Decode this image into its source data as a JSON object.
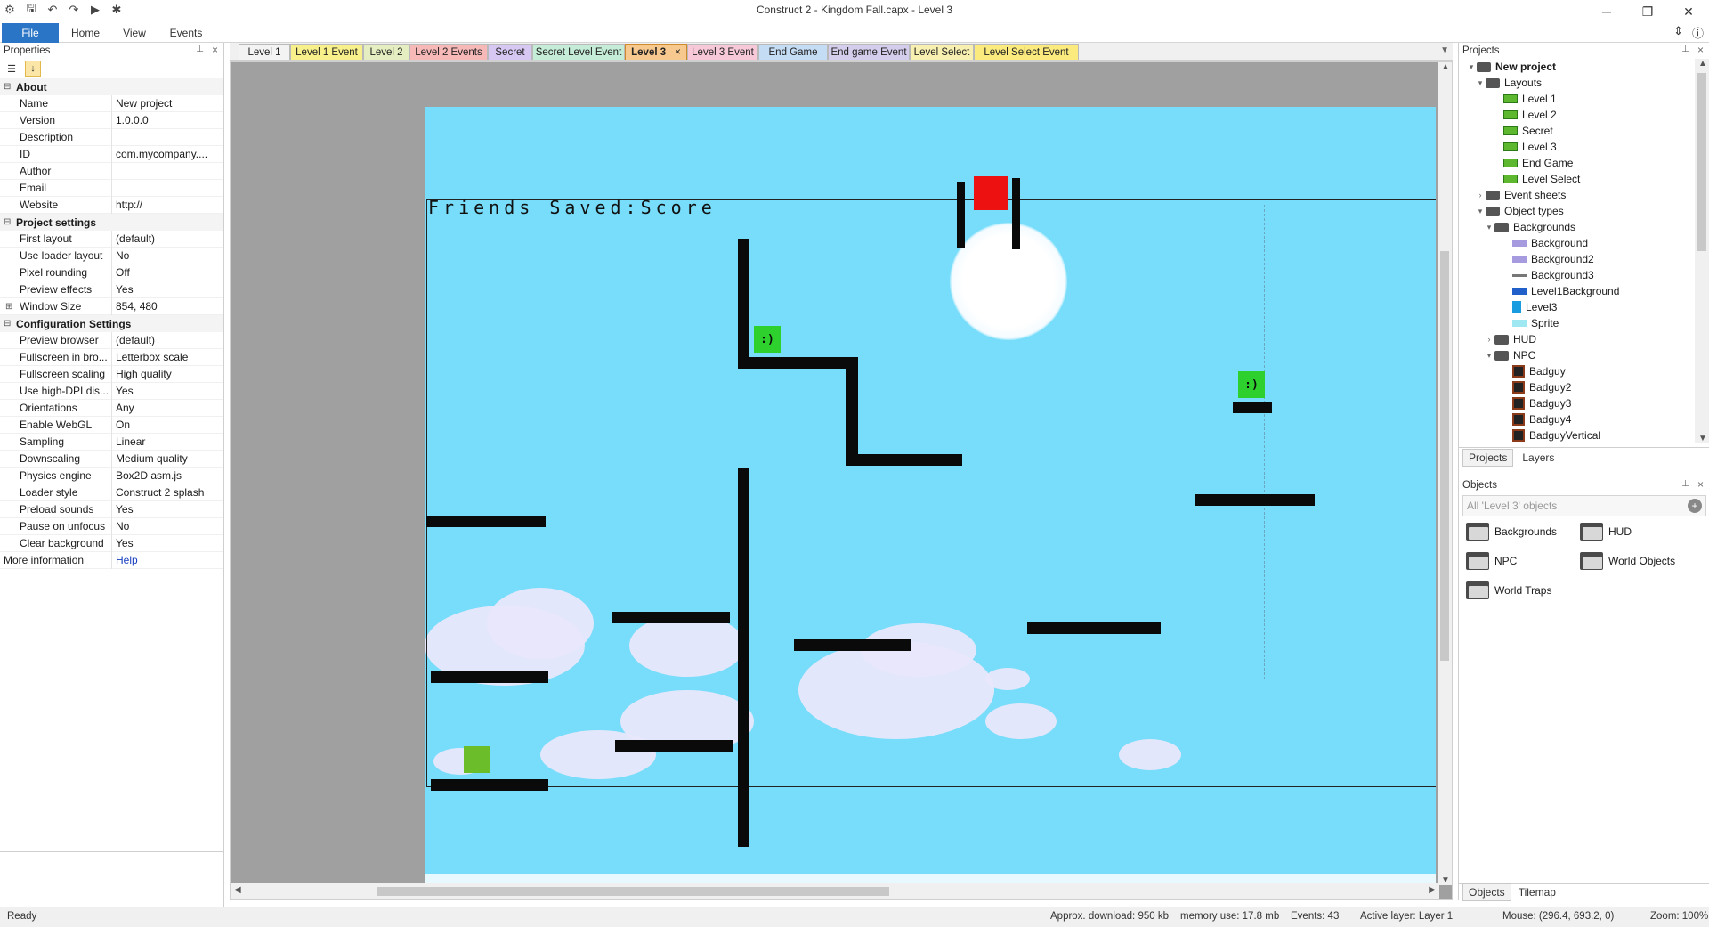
{
  "window": {
    "title": "Construct 2 - Kingdom Fall.capx - Level 3",
    "controls": [
      "─",
      "❐",
      "✕"
    ]
  },
  "ribbon": {
    "tabs": [
      "File",
      "Home",
      "View",
      "Events"
    ]
  },
  "properties": {
    "title": "Properties",
    "sections": {
      "about": "About",
      "project_settings": "Project settings",
      "config": "Configuration Settings"
    },
    "about": [
      {
        "k": "Name",
        "v": "New project"
      },
      {
        "k": "Version",
        "v": "1.0.0.0"
      },
      {
        "k": "Description",
        "v": ""
      },
      {
        "k": "ID",
        "v": "com.mycompany...."
      },
      {
        "k": "Author",
        "v": ""
      },
      {
        "k": "Email",
        "v": ""
      },
      {
        "k": "Website",
        "v": "http://"
      }
    ],
    "project": [
      {
        "k": "First layout",
        "v": "(default)"
      },
      {
        "k": "Use loader layout",
        "v": "No"
      },
      {
        "k": "Pixel rounding",
        "v": "Off"
      },
      {
        "k": "Preview effects",
        "v": "Yes"
      },
      {
        "k": "Window Size",
        "v": "854, 480"
      }
    ],
    "config": [
      {
        "k": "Preview browser",
        "v": "(default)"
      },
      {
        "k": "Fullscreen in bro...",
        "v": "Letterbox scale"
      },
      {
        "k": "Fullscreen scaling",
        "v": "High quality"
      },
      {
        "k": "Use high-DPI dis...",
        "v": "Yes"
      },
      {
        "k": "Orientations",
        "v": "Any"
      },
      {
        "k": "Enable WebGL",
        "v": "On"
      },
      {
        "k": "Sampling",
        "v": "Linear"
      },
      {
        "k": "Downscaling",
        "v": "Medium quality"
      },
      {
        "k": "Physics engine",
        "v": "Box2D asm.js"
      },
      {
        "k": "Loader style",
        "v": "Construct 2 splash"
      },
      {
        "k": "Preload sounds",
        "v": "Yes"
      },
      {
        "k": "Pause on unfocus",
        "v": "No"
      },
      {
        "k": "Clear background",
        "v": "Yes"
      }
    ],
    "more_info": {
      "k": "More information",
      "v": "Help"
    }
  },
  "doc_tabs": [
    {
      "label": "Level 1",
      "color": "#f3f3f3"
    },
    {
      "label": "Level 1 Event",
      "color": "#f8f08a"
    },
    {
      "label": "Level 2",
      "color": "#e4eec0"
    },
    {
      "label": "Level 2 Events",
      "color": "#f7b8b8"
    },
    {
      "label": "Secret",
      "color": "#d6c8f2"
    },
    {
      "label": "Secret Level Event",
      "color": "#c5ecd7"
    },
    {
      "label": "Level 3",
      "color": "#f7c98e",
      "active": true,
      "close": "×"
    },
    {
      "label": "Level 3 Event",
      "color": "#f7c8d8"
    },
    {
      "label": "End Game",
      "color": "#c4dcf4"
    },
    {
      "label": "End game Event",
      "color": "#d4cdeb"
    },
    {
      "label": "Level Select",
      "color": "#f7f0b0"
    },
    {
      "label": "Level Select Event",
      "color": "#fbea7d"
    }
  ],
  "canvas": {
    "hud_text": "Friends Saved:Score",
    "smiley_face": ":)",
    "colors": {
      "sky": "#77ddfa",
      "player": "#2ed02e",
      "trap": "#ee1111"
    }
  },
  "projects": {
    "title": "Projects",
    "tree": [
      {
        "label": "New project",
        "depth": 0,
        "icon": "folder",
        "tw": "▾",
        "bold": true
      },
      {
        "label": "Layouts",
        "depth": 1,
        "icon": "folder",
        "tw": "▾"
      },
      {
        "label": "Level 1",
        "depth": 3,
        "icon": "layout"
      },
      {
        "label": "Level 2",
        "depth": 3,
        "icon": "layout"
      },
      {
        "label": "Secret",
        "depth": 3,
        "icon": "layout"
      },
      {
        "label": "Level 3",
        "depth": 3,
        "icon": "layout"
      },
      {
        "label": "End Game",
        "depth": 3,
        "icon": "layout"
      },
      {
        "label": "Level Select",
        "depth": 3,
        "icon": "layout"
      },
      {
        "label": "Event sheets",
        "depth": 1,
        "icon": "folder",
        "tw": "›"
      },
      {
        "label": "Object types",
        "depth": 1,
        "icon": "folder",
        "tw": "▾"
      },
      {
        "label": "Backgrounds",
        "depth": 2,
        "icon": "folder",
        "tw": "▾"
      },
      {
        "label": "Background",
        "depth": 4,
        "icon": "bg1"
      },
      {
        "label": "Background2",
        "depth": 4,
        "icon": "bg1"
      },
      {
        "label": "Background3",
        "depth": 4,
        "icon": "bg3"
      },
      {
        "label": "Level1Background",
        "depth": 4,
        "icon": "lvl1"
      },
      {
        "label": "Level3",
        "depth": 4,
        "icon": "lvl3"
      },
      {
        "label": "Sprite",
        "depth": 4,
        "icon": "sprite"
      },
      {
        "label": "HUD",
        "depth": 2,
        "icon": "folder",
        "tw": "›"
      },
      {
        "label": "NPC",
        "depth": 2,
        "icon": "folder",
        "tw": "▾"
      },
      {
        "label": "Badguy",
        "depth": 4,
        "icon": "bad"
      },
      {
        "label": "Badguy2",
        "depth": 4,
        "icon": "bad"
      },
      {
        "label": "Badguy3",
        "depth": 4,
        "icon": "bad"
      },
      {
        "label": "Badguy4",
        "depth": 4,
        "icon": "bad"
      },
      {
        "label": "BadguyVertical",
        "depth": 4,
        "icon": "bad"
      }
    ],
    "tabs": [
      "Projects",
      "Layers"
    ]
  },
  "objects": {
    "title": "Objects",
    "filter_placeholder": "All 'Level 3' objects",
    "folders": [
      "Backgrounds",
      "HUD",
      "NPC",
      "World Objects",
      "World Traps"
    ],
    "tabs": [
      "Objects",
      "Tilemap"
    ]
  },
  "status": {
    "ready": "Ready",
    "download": "Approx. download: 950 kb",
    "memory": "memory use: 17.8 mb",
    "events": "Events: 43",
    "layer": "Active layer: Layer 1",
    "mouse": "Mouse: (296.4, 693.2, 0)",
    "zoom": "Zoom: 100%"
  }
}
